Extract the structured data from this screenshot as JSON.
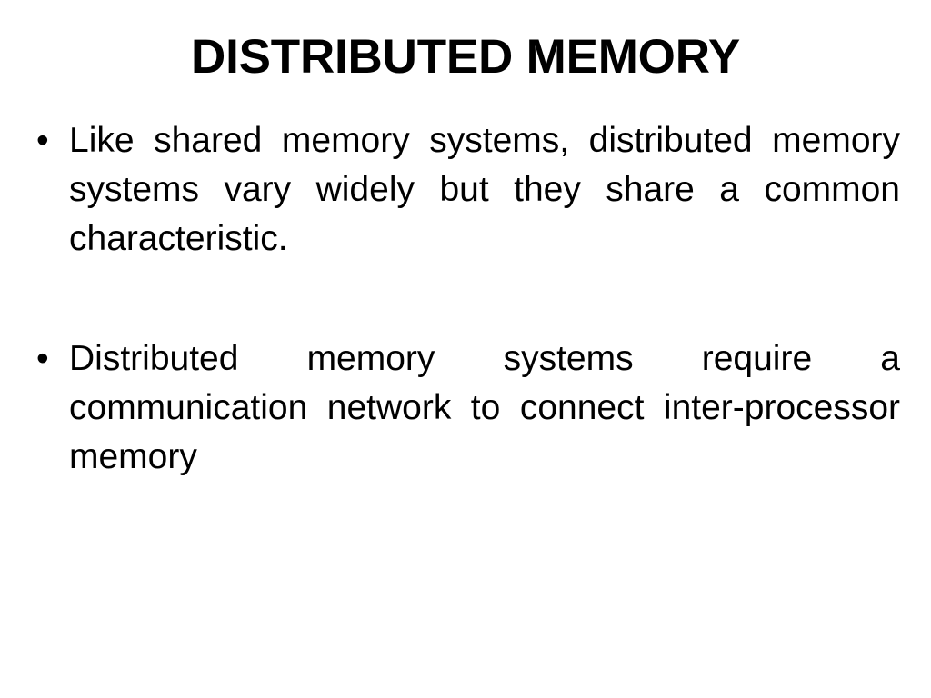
{
  "slide": {
    "title": "DISTRIBUTED MEMORY",
    "background_color": "#ffffff",
    "text_color": "#000000",
    "bullet_glyph": "•",
    "paragraphs": [
      {
        "bullet": "•",
        "text": "Like shared memory systems, distributed memory systems vary widely but they share a common characteristic.",
        "lines": [
          "Like shared memory systems, distributed",
          "memory systems vary widely but they share a",
          "common characteristic."
        ]
      },
      {
        "bullet": "•",
        "text": "Distributed memory systems require a communication network to connect inter-processor memory",
        "lines": [
          "Distributed memory systems require a",
          "communication network to connect inter-",
          "processor memory"
        ]
      }
    ]
  }
}
